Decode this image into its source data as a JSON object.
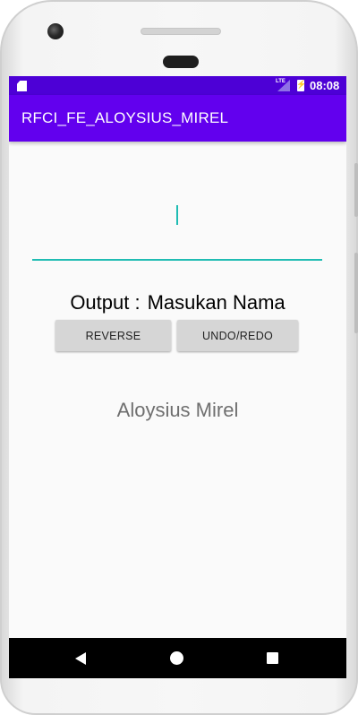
{
  "status_bar": {
    "network": "LTE",
    "time": "08:08"
  },
  "app_bar": {
    "title": "RFCI_FE_ALOYSIUS_MIREL"
  },
  "input": {
    "value": ""
  },
  "output": {
    "label": "Output :",
    "value": "Masukan Nama"
  },
  "buttons": {
    "reverse": "REVERSE",
    "undo_redo": "UNDO/REDO"
  },
  "name_text": "Aloysius Mirel",
  "colors": {
    "status_bar": "#4d00d6",
    "app_bar": "#6200ee",
    "accent": "#1fbcb3"
  },
  "icons": {
    "status": [
      "sd-card-icon",
      "lte-signal-icon",
      "battery-charging-icon"
    ],
    "navigation": [
      "back-icon",
      "home-icon",
      "recent-apps-icon"
    ]
  }
}
